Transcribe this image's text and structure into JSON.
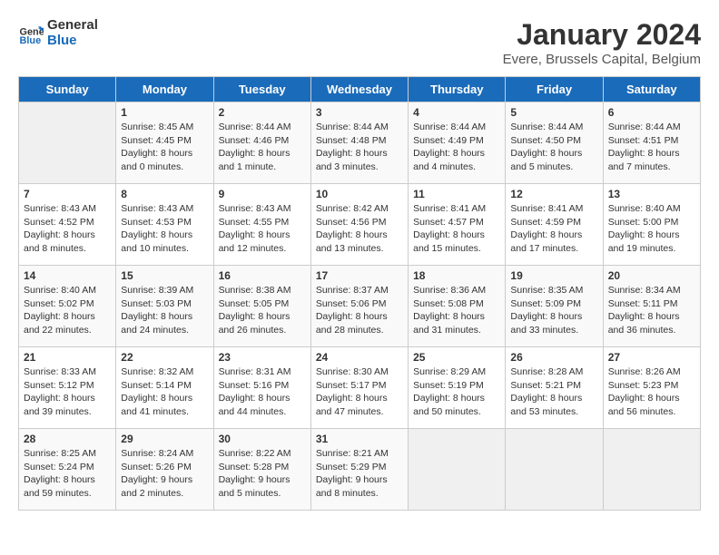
{
  "header": {
    "logo_general": "General",
    "logo_blue": "Blue",
    "month_year": "January 2024",
    "location": "Evere, Brussels Capital, Belgium"
  },
  "days_of_week": [
    "Sunday",
    "Monday",
    "Tuesday",
    "Wednesday",
    "Thursday",
    "Friday",
    "Saturday"
  ],
  "weeks": [
    [
      {
        "day": "",
        "sunrise": "",
        "sunset": "",
        "daylight": ""
      },
      {
        "day": "1",
        "sunrise": "Sunrise: 8:45 AM",
        "sunset": "Sunset: 4:45 PM",
        "daylight": "Daylight: 8 hours and 0 minutes."
      },
      {
        "day": "2",
        "sunrise": "Sunrise: 8:44 AM",
        "sunset": "Sunset: 4:46 PM",
        "daylight": "Daylight: 8 hours and 1 minute."
      },
      {
        "day": "3",
        "sunrise": "Sunrise: 8:44 AM",
        "sunset": "Sunset: 4:48 PM",
        "daylight": "Daylight: 8 hours and 3 minutes."
      },
      {
        "day": "4",
        "sunrise": "Sunrise: 8:44 AM",
        "sunset": "Sunset: 4:49 PM",
        "daylight": "Daylight: 8 hours and 4 minutes."
      },
      {
        "day": "5",
        "sunrise": "Sunrise: 8:44 AM",
        "sunset": "Sunset: 4:50 PM",
        "daylight": "Daylight: 8 hours and 5 minutes."
      },
      {
        "day": "6",
        "sunrise": "Sunrise: 8:44 AM",
        "sunset": "Sunset: 4:51 PM",
        "daylight": "Daylight: 8 hours and 7 minutes."
      }
    ],
    [
      {
        "day": "7",
        "sunrise": "Sunrise: 8:43 AM",
        "sunset": "Sunset: 4:52 PM",
        "daylight": "Daylight: 8 hours and 8 minutes."
      },
      {
        "day": "8",
        "sunrise": "Sunrise: 8:43 AM",
        "sunset": "Sunset: 4:53 PM",
        "daylight": "Daylight: 8 hours and 10 minutes."
      },
      {
        "day": "9",
        "sunrise": "Sunrise: 8:43 AM",
        "sunset": "Sunset: 4:55 PM",
        "daylight": "Daylight: 8 hours and 12 minutes."
      },
      {
        "day": "10",
        "sunrise": "Sunrise: 8:42 AM",
        "sunset": "Sunset: 4:56 PM",
        "daylight": "Daylight: 8 hours and 13 minutes."
      },
      {
        "day": "11",
        "sunrise": "Sunrise: 8:41 AM",
        "sunset": "Sunset: 4:57 PM",
        "daylight": "Daylight: 8 hours and 15 minutes."
      },
      {
        "day": "12",
        "sunrise": "Sunrise: 8:41 AM",
        "sunset": "Sunset: 4:59 PM",
        "daylight": "Daylight: 8 hours and 17 minutes."
      },
      {
        "day": "13",
        "sunrise": "Sunrise: 8:40 AM",
        "sunset": "Sunset: 5:00 PM",
        "daylight": "Daylight: 8 hours and 19 minutes."
      }
    ],
    [
      {
        "day": "14",
        "sunrise": "Sunrise: 8:40 AM",
        "sunset": "Sunset: 5:02 PM",
        "daylight": "Daylight: 8 hours and 22 minutes."
      },
      {
        "day": "15",
        "sunrise": "Sunrise: 8:39 AM",
        "sunset": "Sunset: 5:03 PM",
        "daylight": "Daylight: 8 hours and 24 minutes."
      },
      {
        "day": "16",
        "sunrise": "Sunrise: 8:38 AM",
        "sunset": "Sunset: 5:05 PM",
        "daylight": "Daylight: 8 hours and 26 minutes."
      },
      {
        "day": "17",
        "sunrise": "Sunrise: 8:37 AM",
        "sunset": "Sunset: 5:06 PM",
        "daylight": "Daylight: 8 hours and 28 minutes."
      },
      {
        "day": "18",
        "sunrise": "Sunrise: 8:36 AM",
        "sunset": "Sunset: 5:08 PM",
        "daylight": "Daylight: 8 hours and 31 minutes."
      },
      {
        "day": "19",
        "sunrise": "Sunrise: 8:35 AM",
        "sunset": "Sunset: 5:09 PM",
        "daylight": "Daylight: 8 hours and 33 minutes."
      },
      {
        "day": "20",
        "sunrise": "Sunrise: 8:34 AM",
        "sunset": "Sunset: 5:11 PM",
        "daylight": "Daylight: 8 hours and 36 minutes."
      }
    ],
    [
      {
        "day": "21",
        "sunrise": "Sunrise: 8:33 AM",
        "sunset": "Sunset: 5:12 PM",
        "daylight": "Daylight: 8 hours and 39 minutes."
      },
      {
        "day": "22",
        "sunrise": "Sunrise: 8:32 AM",
        "sunset": "Sunset: 5:14 PM",
        "daylight": "Daylight: 8 hours and 41 minutes."
      },
      {
        "day": "23",
        "sunrise": "Sunrise: 8:31 AM",
        "sunset": "Sunset: 5:16 PM",
        "daylight": "Daylight: 8 hours and 44 minutes."
      },
      {
        "day": "24",
        "sunrise": "Sunrise: 8:30 AM",
        "sunset": "Sunset: 5:17 PM",
        "daylight": "Daylight: 8 hours and 47 minutes."
      },
      {
        "day": "25",
        "sunrise": "Sunrise: 8:29 AM",
        "sunset": "Sunset: 5:19 PM",
        "daylight": "Daylight: 8 hours and 50 minutes."
      },
      {
        "day": "26",
        "sunrise": "Sunrise: 8:28 AM",
        "sunset": "Sunset: 5:21 PM",
        "daylight": "Daylight: 8 hours and 53 minutes."
      },
      {
        "day": "27",
        "sunrise": "Sunrise: 8:26 AM",
        "sunset": "Sunset: 5:23 PM",
        "daylight": "Daylight: 8 hours and 56 minutes."
      }
    ],
    [
      {
        "day": "28",
        "sunrise": "Sunrise: 8:25 AM",
        "sunset": "Sunset: 5:24 PM",
        "daylight": "Daylight: 8 hours and 59 minutes."
      },
      {
        "day": "29",
        "sunrise": "Sunrise: 8:24 AM",
        "sunset": "Sunset: 5:26 PM",
        "daylight": "Daylight: 9 hours and 2 minutes."
      },
      {
        "day": "30",
        "sunrise": "Sunrise: 8:22 AM",
        "sunset": "Sunset: 5:28 PM",
        "daylight": "Daylight: 9 hours and 5 minutes."
      },
      {
        "day": "31",
        "sunrise": "Sunrise: 8:21 AM",
        "sunset": "Sunset: 5:29 PM",
        "daylight": "Daylight: 9 hours and 8 minutes."
      },
      {
        "day": "",
        "sunrise": "",
        "sunset": "",
        "daylight": ""
      },
      {
        "day": "",
        "sunrise": "",
        "sunset": "",
        "daylight": ""
      },
      {
        "day": "",
        "sunrise": "",
        "sunset": "",
        "daylight": ""
      }
    ]
  ]
}
